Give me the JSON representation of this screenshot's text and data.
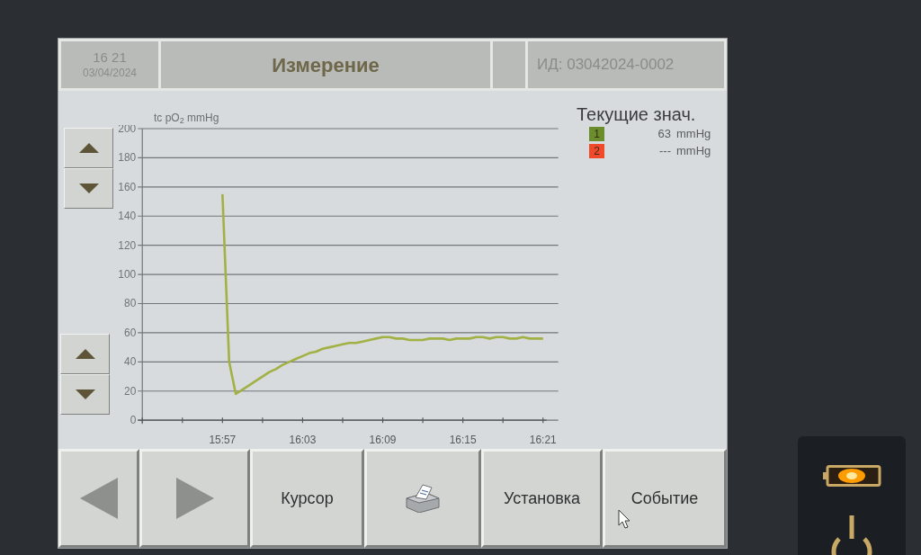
{
  "header": {
    "time": "16 21",
    "date": "03/04/2024",
    "title": "Измерение",
    "id": "ИД: 03042024-0002"
  },
  "chart": {
    "chart_data": {
      "type": "line",
      "ylabel": "tc pO$_{2}$ mmHg",
      "grid": true,
      "categories": [
        null,
        null,
        null,
        null,
        null,
        null,
        null,
        null,
        null,
        null,
        null,
        null,
        "15:57",
        null,
        null,
        null,
        null,
        null,
        null,
        null,
        null,
        null,
        null,
        null,
        "16:03",
        null,
        null,
        null,
        null,
        null,
        null,
        null,
        null,
        null,
        null,
        null,
        "16:09",
        null,
        null,
        null,
        null,
        null,
        null,
        null,
        null,
        null,
        null,
        null,
        "16:15",
        null,
        null,
        null,
        null,
        null,
        null,
        null,
        null,
        null,
        null,
        null,
        "16:21"
      ],
      "series": [
        {
          "color": "#a2b144",
          "values": [
            null,
            null,
            null,
            null,
            null,
            null,
            null,
            null,
            null,
            null,
            null,
            null,
            155,
            40,
            18,
            21,
            24,
            27,
            30,
            33,
            35,
            38,
            40,
            42,
            44,
            46,
            47,
            49,
            50,
            51,
            52,
            53,
            53,
            54,
            55,
            56,
            57,
            57,
            56,
            56,
            55,
            55,
            55,
            56,
            56,
            56,
            55,
            56,
            56,
            56,
            57,
            57,
            56,
            57,
            57,
            56,
            56,
            57,
            56,
            56,
            56
          ]
        }
      ],
      "ylim": [
        0,
        200
      ],
      "yticks": [
        0,
        20,
        40,
        60,
        80,
        100,
        120,
        140,
        160,
        180,
        200
      ]
    }
  },
  "current_values": {
    "title": "Текущие знач.",
    "items": [
      {
        "channel": "1",
        "color": "#6b8e2c",
        "value": "63",
        "unit": "mmHg"
      },
      {
        "channel": "2",
        "color": "#f04a2a",
        "value": "---",
        "unit": "mmHg"
      }
    ]
  },
  "buttons": [
    {
      "kind": "prev",
      "pointer": false
    },
    {
      "kind": "next",
      "pointer": false
    },
    {
      "kind": "text",
      "label": "Курсор",
      "pointer": false
    },
    {
      "kind": "print",
      "pointer": false
    },
    {
      "kind": "text",
      "label": "Установка",
      "pointer": false
    },
    {
      "kind": "text",
      "label": "Событие",
      "pointer": true
    }
  ]
}
